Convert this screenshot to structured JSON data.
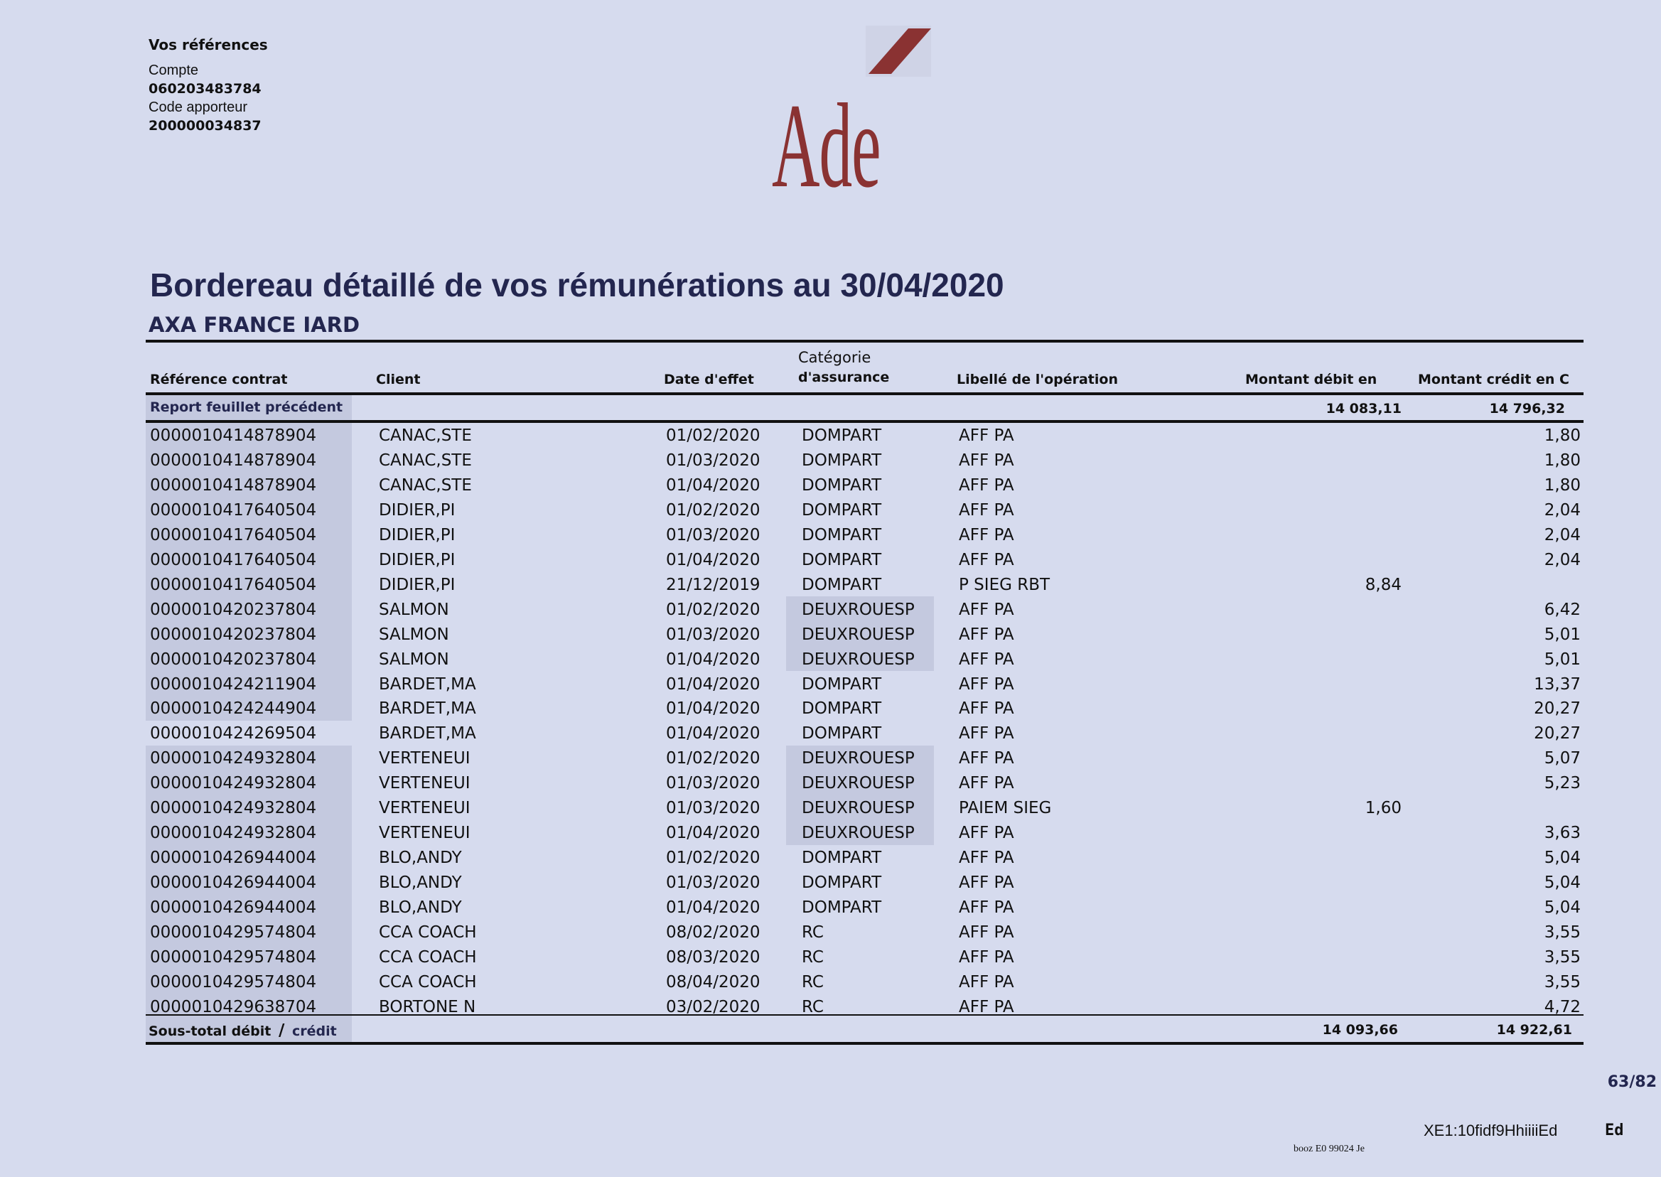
{
  "references": {
    "heading": "Vos références",
    "account_label": "Compte",
    "account_value": "060203483784",
    "provider_label": "Code apporteur",
    "provider_value": "200000034837"
  },
  "logo": {
    "text": "Ade",
    "color": "#8a3232"
  },
  "title": "Bordereau détaillé de vos rémunérations au 30/04/2020",
  "company": "AXA FRANCE IARD",
  "columns": {
    "ref": "Référence contrat",
    "client": "Client",
    "date": "Date d'effet",
    "category_line1": "Catégorie",
    "category_line2": "d'assurance",
    "label": "Libellé de l'opération",
    "debit": "Montant débit en",
    "credit": "Montant crédit en C"
  },
  "report": {
    "label": "Report feuillet précédent",
    "debit": "14 083,11",
    "credit": "14 796,32"
  },
  "rows": [
    {
      "ref": "0000010414878904",
      "client": "CANAC,STE",
      "date": "01/02/2020",
      "category": "DOMPART",
      "label": "AFF PA",
      "debit": "",
      "credit": "1,80"
    },
    {
      "ref": "0000010414878904",
      "client": "CANAC,STE",
      "date": "01/03/2020",
      "category": "DOMPART",
      "label": "AFF PA",
      "debit": "",
      "credit": "1,80"
    },
    {
      "ref": "0000010414878904",
      "client": "CANAC,STE",
      "date": "01/04/2020",
      "category": "DOMPART",
      "label": "AFF PA",
      "debit": "",
      "credit": "1,80"
    },
    {
      "ref": "0000010417640504",
      "client": "DIDIER,PI",
      "date": "01/02/2020",
      "category": "DOMPART",
      "label": "AFF PA",
      "debit": "",
      "credit": "2,04"
    },
    {
      "ref": "0000010417640504",
      "client": "DIDIER,PI",
      "date": "01/03/2020",
      "category": "DOMPART",
      "label": "AFF PA",
      "debit": "",
      "credit": "2,04"
    },
    {
      "ref": "0000010417640504",
      "client": "DIDIER,PI",
      "date": "01/04/2020",
      "category": "DOMPART",
      "label": "AFF PA",
      "debit": "",
      "credit": "2,04"
    },
    {
      "ref": "0000010417640504",
      "client": "DIDIER,PI",
      "date": "21/12/2019",
      "category": "DOMPART",
      "label": "P SIEG RBT",
      "debit": "8,84",
      "credit": ""
    },
    {
      "ref": "0000010420237804",
      "client": "SALMON",
      "date": "01/02/2020",
      "category": "DEUXROUESP",
      "label": "AFF PA",
      "debit": "",
      "credit": "6,42"
    },
    {
      "ref": "0000010420237804",
      "client": "SALMON",
      "date": "01/03/2020",
      "category": "DEUXROUESP",
      "label": "AFF PA",
      "debit": "",
      "credit": "5,01"
    },
    {
      "ref": "0000010420237804",
      "client": "SALMON",
      "date": "01/04/2020",
      "category": "DEUXROUESP",
      "label": "AFF PA",
      "debit": "",
      "credit": "5,01"
    },
    {
      "ref": "0000010424211904",
      "client": "BARDET,MA",
      "date": "01/04/2020",
      "category": "DOMPART",
      "label": "AFF PA",
      "debit": "",
      "credit": "13,37"
    },
    {
      "ref": "0000010424244904",
      "client": "BARDET,MA",
      "date": "01/04/2020",
      "category": "DOMPART",
      "label": "AFF PA",
      "debit": "",
      "credit": "20,27"
    },
    {
      "ref": "0000010424269504",
      "client": "BARDET,MA",
      "date": "01/04/2020",
      "category": "DOMPART",
      "label": "AFF PA",
      "debit": "",
      "credit": "20,27"
    },
    {
      "ref": "0000010424932804",
      "client": "VERTENEUI",
      "date": "01/02/2020",
      "category": "DEUXROUESP",
      "label": "AFF PA",
      "debit": "",
      "credit": "5,07"
    },
    {
      "ref": "0000010424932804",
      "client": "VERTENEUI",
      "date": "01/03/2020",
      "category": "DEUXROUESP",
      "label": "AFF PA",
      "debit": "",
      "credit": "5,23"
    },
    {
      "ref": "0000010424932804",
      "client": "VERTENEUI",
      "date": "01/03/2020",
      "category": "DEUXROUESP",
      "label": "PAIEM SIEG",
      "debit": "1,60",
      "credit": ""
    },
    {
      "ref": "0000010424932804",
      "client": "VERTENEUI",
      "date": "01/04/2020",
      "category": "DEUXROUESP",
      "label": "AFF PA",
      "debit": "",
      "credit": "3,63"
    },
    {
      "ref": "0000010426944004",
      "client": "BLO,ANDY",
      "date": "01/02/2020",
      "category": "DOMPART",
      "label": "AFF PA",
      "debit": "",
      "credit": "5,04"
    },
    {
      "ref": "0000010426944004",
      "client": "BLO,ANDY",
      "date": "01/03/2020",
      "category": "DOMPART",
      "label": "AFF PA",
      "debit": "",
      "credit": "5,04"
    },
    {
      "ref": "0000010426944004",
      "client": "BLO,ANDY",
      "date": "01/04/2020",
      "category": "DOMPART",
      "label": "AFF PA",
      "debit": "",
      "credit": "5,04"
    },
    {
      "ref": "0000010429574804",
      "client": "CCA COACH",
      "date": "08/02/2020",
      "category": "RC",
      "label": "AFF PA",
      "debit": "",
      "credit": "3,55"
    },
    {
      "ref": "0000010429574804",
      "client": "CCA COACH",
      "date": "08/03/2020",
      "category": "RC",
      "label": "AFF PA",
      "debit": "",
      "credit": "3,55"
    },
    {
      "ref": "0000010429574804",
      "client": "CCA COACH",
      "date": "08/04/2020",
      "category": "RC",
      "label": "AFF PA",
      "debit": "",
      "credit": "3,55"
    },
    {
      "ref": "0000010429638704",
      "client": "BORTONE N",
      "date": "03/02/2020",
      "category": "RC",
      "label": "AFF PA",
      "debit": "",
      "credit": "4,72"
    }
  ],
  "subtotal": {
    "label_debit": "Sous-total débit",
    "slash": "/",
    "label_credit": "crédit",
    "debit": "14 093,66",
    "credit": "14 922,61"
  },
  "page_number": "63/82",
  "footer": {
    "code": "XE1:10fidf9HhiiiiEd",
    "ed": "Ed",
    "small": "booz E0 99024  Je"
  }
}
